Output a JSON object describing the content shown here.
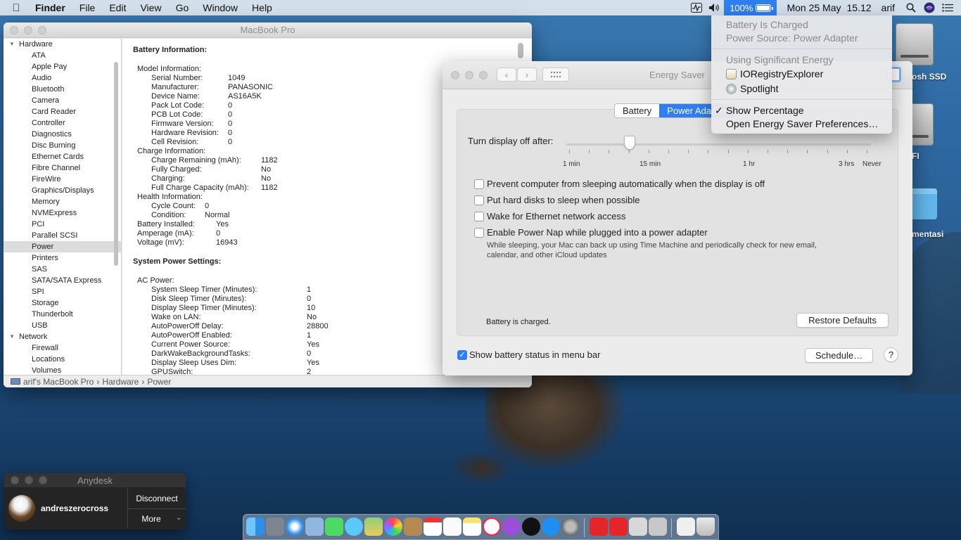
{
  "menubar": {
    "app": "Finder",
    "items": [
      "File",
      "Edit",
      "View",
      "Go",
      "Window",
      "Help"
    ],
    "battery_percent": "100%",
    "date": "Mon 25 May",
    "time": "15.12",
    "user": "arif"
  },
  "battery_menu": {
    "status": "Battery Is Charged",
    "source": "Power Source: Power Adapter",
    "energy_header": "Using Significant Energy",
    "apps": [
      "IORegistryExplorer",
      "Spotlight"
    ],
    "show_percentage": "Show Percentage",
    "check": "✓",
    "open_prefs": "Open Energy Saver Preferences…"
  },
  "sysinfo": {
    "title": "MacBook Pro",
    "sidebar": {
      "hardware": "Hardware",
      "hw_items": [
        "ATA",
        "Apple Pay",
        "Audio",
        "Bluetooth",
        "Camera",
        "Card Reader",
        "Controller",
        "Diagnostics",
        "Disc Burning",
        "Ethernet Cards",
        "Fibre Channel",
        "FireWire",
        "Graphics/Displays",
        "Memory",
        "NVMExpress",
        "PCI",
        "Parallel SCSI",
        "Power",
        "Printers",
        "SAS",
        "SATA/SATA Express",
        "SPI",
        "Storage",
        "Thunderbolt",
        "USB"
      ],
      "network": "Network",
      "net_items": [
        "Firewall",
        "Locations",
        "Volumes"
      ]
    },
    "battery_info_header": "Battery Information:",
    "model_info": "Model Information:",
    "model_rows": [
      [
        "Serial Number:",
        "1049"
      ],
      [
        "Manufacturer:",
        "PANASONIC"
      ],
      [
        "Device Name:",
        "AS16A5K"
      ],
      [
        "Pack Lot Code:",
        "0"
      ],
      [
        "PCB Lot Code:",
        "0"
      ],
      [
        "Firmware Version:",
        "0"
      ],
      [
        "Hardware Revision:",
        "0"
      ],
      [
        "Cell Revision:",
        "0"
      ]
    ],
    "charge_info": "Charge Information:",
    "charge_rows": [
      [
        "Charge Remaining (mAh):",
        "1182"
      ],
      [
        "Fully Charged:",
        "No"
      ],
      [
        "Charging:",
        "No"
      ],
      [
        "Full Charge Capacity (mAh):",
        "1182"
      ]
    ],
    "health_info": "Health Information:",
    "health_rows": [
      [
        "Cycle Count:",
        "0"
      ],
      [
        "Condition:",
        "Normal"
      ]
    ],
    "top_rows": [
      [
        "Battery Installed:",
        "Yes"
      ],
      [
        "Amperage (mA):",
        "0"
      ],
      [
        "Voltage (mV):",
        "16943"
      ]
    ],
    "power_settings_header": "System Power Settings:",
    "ac_power": "AC Power:",
    "ac_rows": [
      [
        "System Sleep Timer (Minutes):",
        "1"
      ],
      [
        "Disk Sleep Timer (Minutes):",
        "0"
      ],
      [
        "Display Sleep Timer (Minutes):",
        "10"
      ],
      [
        "Wake on LAN:",
        "No"
      ],
      [
        "AutoPowerOff Delay:",
        "28800"
      ],
      [
        "AutoPowerOff Enabled:",
        "1"
      ],
      [
        "Current Power Source:",
        "Yes"
      ],
      [
        "DarkWakeBackgroundTasks:",
        "0"
      ],
      [
        "Display Sleep Uses Dim:",
        "Yes"
      ],
      [
        "GPUSwitch:",
        "2"
      ]
    ],
    "path": [
      "arif's MacBook Pro",
      "Hardware",
      "Power"
    ],
    "path_sep": "›"
  },
  "energy": {
    "title": "Energy Saver",
    "tabs": [
      "Battery",
      "Power Adapter"
    ],
    "active_tab": "Power Adapter",
    "display_off_label": "Turn display off after:",
    "slider_value_label": "10 min",
    "tick_labels": [
      "1 min",
      "15 min",
      "1 hr",
      "3 hrs",
      "Never"
    ],
    "options": [
      {
        "label": "Prevent computer from sleeping automatically when the display is off",
        "checked": false
      },
      {
        "label": "Put hard disks to sleep when possible",
        "checked": false
      },
      {
        "label": "Wake for Ethernet network access",
        "checked": false
      },
      {
        "label": "Enable Power Nap while plugged into a power adapter",
        "checked": false
      }
    ],
    "powernap_desc_1": "While sleeping, your Mac can back up using Time Machine and periodically check for new email,",
    "powernap_desc_2": "calendar, and other iCloud updates",
    "status": "Battery is charged.",
    "restore": "Restore Defaults",
    "show_status": "Show battery status in menu bar",
    "show_status_checked": true,
    "schedule": "Schedule…",
    "help": "?"
  },
  "desktop": {
    "icons": [
      "osh SSD",
      "FI",
      "mentasi"
    ]
  },
  "anydesk": {
    "title": "Anydesk",
    "user": "andreszerocross",
    "disconnect": "Disconnect",
    "more": "More"
  },
  "colors": {
    "accent": "#2f7ff0",
    "desktop_top": "#3a78b0",
    "desktop_bottom": "#112f52"
  }
}
